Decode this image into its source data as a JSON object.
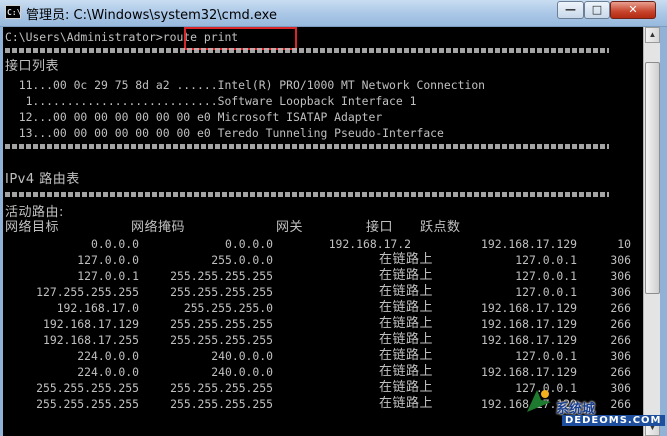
{
  "window": {
    "icon_text": "C:\\",
    "title": "管理员: C:\\Windows\\system32\\cmd.exe",
    "controls": {
      "minimize": "—",
      "maximize": "□",
      "close": "✕"
    }
  },
  "console": {
    "prompt": "C:\\Users\\Administrator>",
    "command": "route print",
    "interface_list_title": "接口列表",
    "interfaces": [
      "  11...00 0c 29 75 8d a2 ......Intel(R) PRO/1000 MT Network Connection",
      "   1...........................Software Loopback Interface 1",
      "  12...00 00 00 00 00 00 00 e0 Microsoft ISATAP Adapter",
      "  13...00 00 00 00 00 00 00 e0 Teredo Tunneling Pseudo-Interface"
    ],
    "ipv4_title": "IPv4 路由表",
    "active_routes_title": "活动路由:",
    "headers": [
      "网络目标",
      "网络掩码",
      "网关",
      "接口",
      "跃点数"
    ],
    "routes": [
      [
        "0.0.0.0",
        "0.0.0.0",
        "192.168.17.2",
        "192.168.17.129",
        "10"
      ],
      [
        "127.0.0.0",
        "255.0.0.0",
        "在链路上",
        "127.0.0.1",
        "306"
      ],
      [
        "127.0.0.1",
        "255.255.255.255",
        "在链路上",
        "127.0.0.1",
        "306"
      ],
      [
        "127.255.255.255",
        "255.255.255.255",
        "在链路上",
        "127.0.0.1",
        "306"
      ],
      [
        "192.168.17.0",
        "255.255.255.0",
        "在链路上",
        "192.168.17.129",
        "266"
      ],
      [
        "192.168.17.129",
        "255.255.255.255",
        "在链路上",
        "192.168.17.129",
        "266"
      ],
      [
        "192.168.17.255",
        "255.255.255.255",
        "在链路上",
        "192.168.17.129",
        "266"
      ],
      [
        "224.0.0.0",
        "240.0.0.0",
        "在链路上",
        "127.0.0.1",
        "306"
      ],
      [
        "224.0.0.0",
        "240.0.0.0",
        "在链路上",
        "192.168.17.129",
        "266"
      ],
      [
        "255.255.255.255",
        "255.255.255.255",
        "在链路上",
        "127.0.0.1",
        "306"
      ],
      [
        "255.255.255.255",
        "255.255.255.255",
        "在链路上",
        "192.168.17.129",
        "266"
      ]
    ]
  },
  "scrollbar": {
    "up": "▲",
    "down": "▼"
  },
  "watermark": {
    "line1": "系统城",
    "line2": "DEDEOMS.COM"
  },
  "colors": {
    "console_bg": "#000000",
    "console_text": "#c0c0c0",
    "highlight": "#d9262b"
  }
}
